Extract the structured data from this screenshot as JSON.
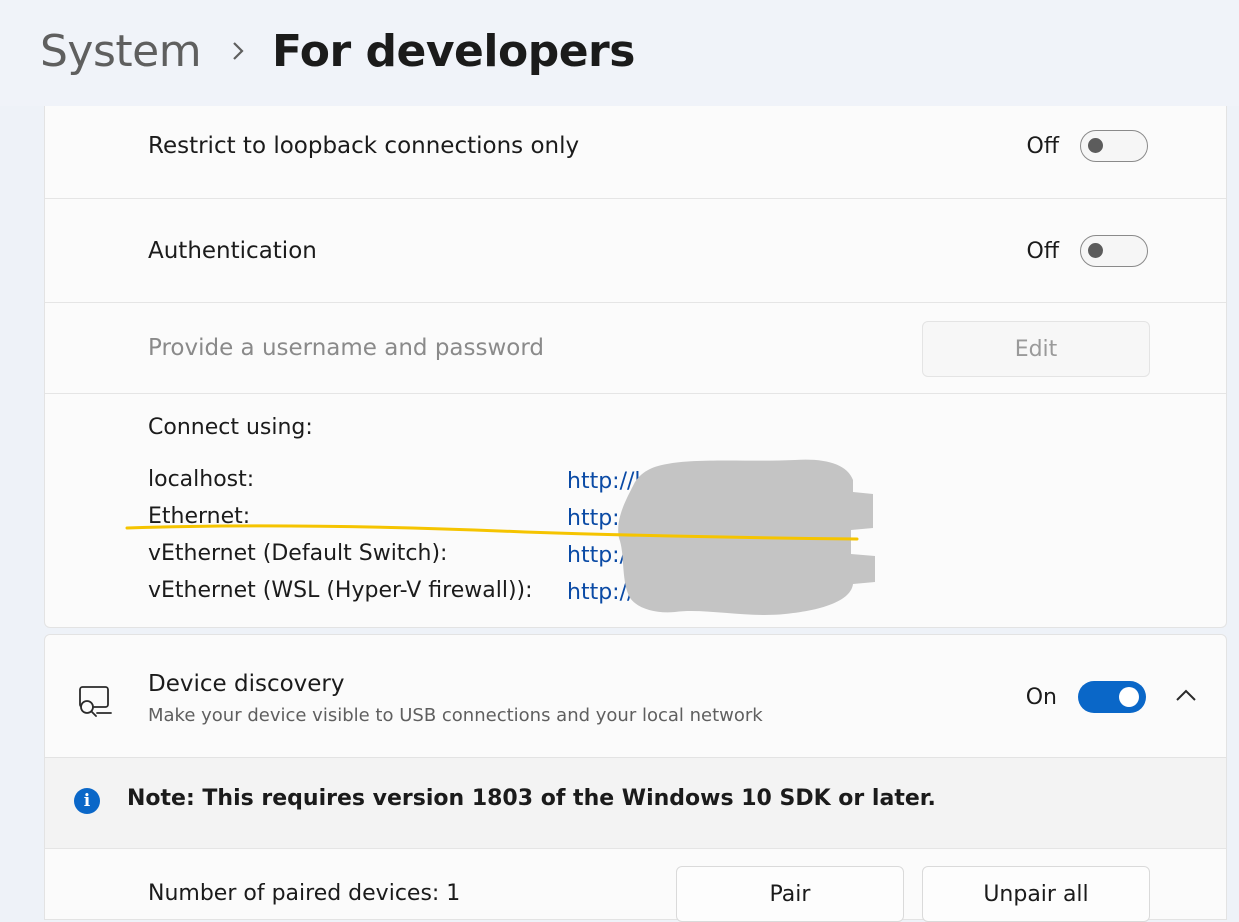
{
  "breadcrumb": {
    "parent": "System",
    "current": "For developers"
  },
  "loopback": {
    "label": "Restrict to loopback connections only",
    "state": "Off",
    "enabled": false
  },
  "authentication": {
    "label": "Authentication",
    "state": "Off",
    "enabled": false
  },
  "credentials": {
    "label": "Provide a username and password",
    "button": "Edit"
  },
  "connect": {
    "heading": "Connect using:",
    "rows": [
      {
        "name": "localhost:",
        "url": "http://lo"
      },
      {
        "name": "Ethernet:",
        "url": "http://"
      },
      {
        "name": "vEthernet (Default Switch):",
        "url": "http://"
      },
      {
        "name": "vEthernet (WSL (Hyper-V firewall)):",
        "url": "http://"
      }
    ]
  },
  "device_discovery": {
    "title": "Device discovery",
    "subtitle": "Make your device visible to USB connections and your local network",
    "state": "On",
    "enabled": true,
    "icon": "device-discovery-icon"
  },
  "note": {
    "text": "Note: This requires version 1803 of the Windows 10 SDK or later.",
    "icon": "info-icon"
  },
  "pairing": {
    "label": "Number of paired devices: 1",
    "pair_button": "Pair",
    "unpair_button": "Unpair all"
  },
  "colors": {
    "accent": "#0a67c8",
    "link": "#0a4aa5",
    "highlight": "#f5c400",
    "redaction": "#c4c4c4"
  }
}
